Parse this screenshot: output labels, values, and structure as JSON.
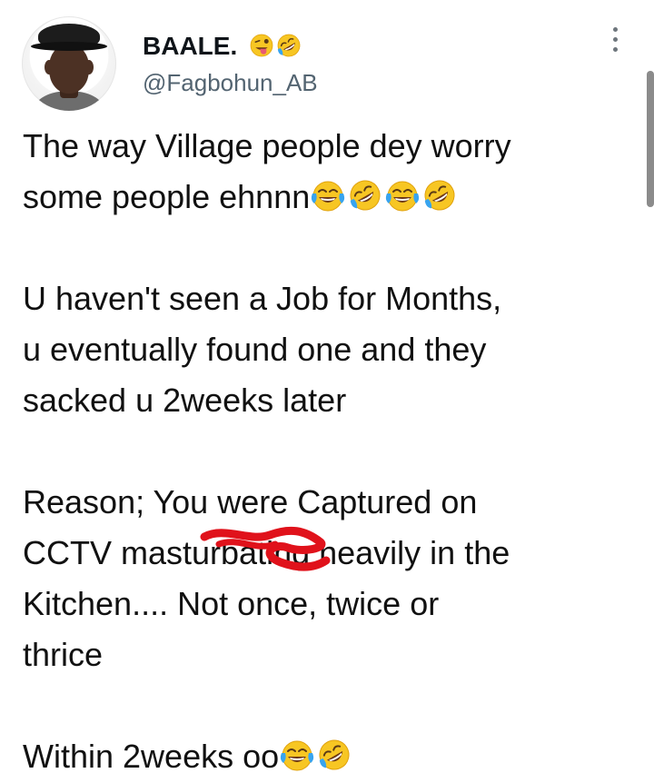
{
  "user": {
    "display_name": "BAALE.",
    "display_name_emojis": [
      "face-with-tongue-winking",
      "rolling-on-the-floor-laughing"
    ],
    "handle": "@Fagbohun_AB"
  },
  "tweet": {
    "line1": "The way Village people dey worry",
    "line2": "some people ehnnn",
    "line2_emojis": [
      "face-with-tears-of-joy",
      "rolling-on-the-floor-laughing",
      "face-with-tears-of-joy",
      "rolling-on-the-floor-laughing"
    ],
    "line3": "U haven't seen a Job for Months,",
    "line4": "u eventually found one and they",
    "line5": "sacked u 2weeks later",
    "line6": "Reason; You were Captured on",
    "line7_prefix": "CCTV ",
    "line7_word": "masturbating",
    "line7_suffix": " heavily in the",
    "line8": "Kitchen.... Not once, twice or",
    "line9": "thrice",
    "line10": "Within 2weeks oo",
    "line10_emojis": [
      "face-with-tears-of-joy",
      "rolling-on-the-floor-laughing"
    ]
  },
  "colors": {
    "text": "#111111",
    "handle": "#536471",
    "censor_red": "#e0121b",
    "emoji_yellow": "#f7c623"
  }
}
